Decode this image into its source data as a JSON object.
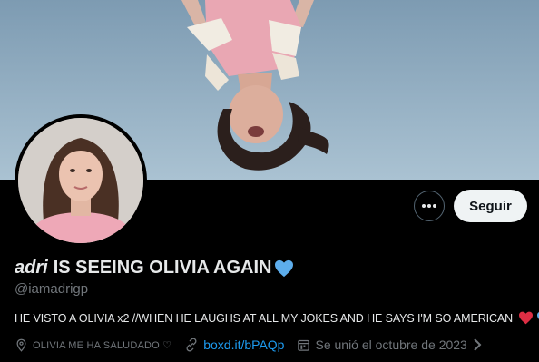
{
  "profile": {
    "name_italic": "adri",
    "name_rest": "IS SEEING OLIVIA AGAIN",
    "handle": "@iamadrigp",
    "bio": "HE VISTO A OLIVIA x2 //WHEN HE LAUGHS AT ALL MY JOKES AND HE SAYS I'M SO AMERICAN",
    "location": "OLIVIA ME HA SALUDADO ♡",
    "website": "boxd.it/bPAQp",
    "joined": "Se unió el octubre de 2023"
  },
  "actions": {
    "follow_label": "Seguir"
  },
  "colors": {
    "accent": "#1d9bf0",
    "heart_red": "#e0245e",
    "heart_blue": "#5dadec"
  },
  "icons": [
    "more-icon",
    "location-icon",
    "link-icon",
    "calendar-icon",
    "blue-heart-icon",
    "red-heart-icon",
    "chevron-right-icon"
  ]
}
